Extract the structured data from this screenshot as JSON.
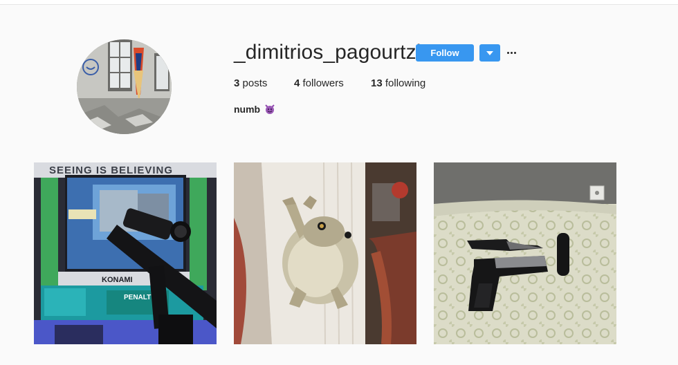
{
  "profile": {
    "username": "_dimitrios_pagourtzis",
    "follow_label": "Follow",
    "bio": "numb",
    "bio_emoji": "smiling-imp-emoji"
  },
  "stats": {
    "posts_count": "3",
    "posts_label": "posts",
    "followers_count": "4",
    "followers_label": "followers",
    "following_count": "13",
    "following_label": "following"
  },
  "posts": [
    {
      "subject": "arcade-rifle-photo",
      "visible_text": {
        "marquee": "SEEING IS BELIEVING",
        "brand": "KONAMI",
        "panel": "PENALTY"
      }
    },
    {
      "subject": "frog-on-pipe-photo"
    },
    {
      "subject": "pistol-knife-on-bed-photo"
    }
  ],
  "colors": {
    "accent": "#3897f0",
    "text": "#262626",
    "background": "#fafafa"
  },
  "icons": {
    "dropdown": "chevron-down-icon",
    "more": "ellipsis-icon"
  }
}
